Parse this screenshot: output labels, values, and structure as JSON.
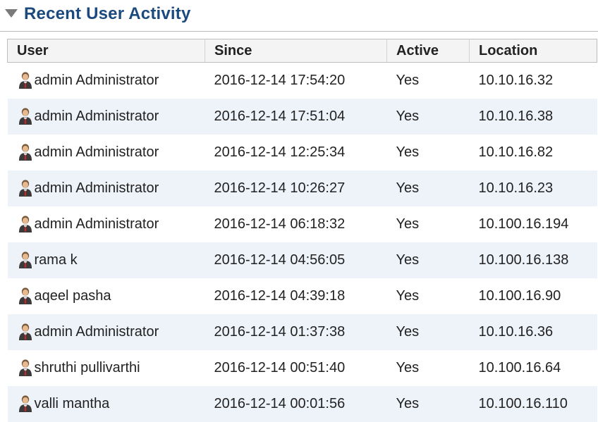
{
  "panel": {
    "title": "Recent User Activity"
  },
  "table": {
    "columns": [
      "User",
      "Since",
      "Active",
      "Location"
    ],
    "rows": [
      {
        "user": "admin Administrator",
        "since": "2016-12-14 17:54:20",
        "active": "Yes",
        "location": "10.10.16.32"
      },
      {
        "user": "admin Administrator",
        "since": "2016-12-14 17:51:04",
        "active": "Yes",
        "location": "10.10.16.38"
      },
      {
        "user": "admin Administrator",
        "since": "2016-12-14 12:25:34",
        "active": "Yes",
        "location": "10.10.16.82"
      },
      {
        "user": "admin Administrator",
        "since": "2016-12-14 10:26:27",
        "active": "Yes",
        "location": "10.10.16.23"
      },
      {
        "user": "admin Administrator",
        "since": "2016-12-14 06:18:32",
        "active": "Yes",
        "location": "10.100.16.194"
      },
      {
        "user": "rama k",
        "since": "2016-12-14 04:56:05",
        "active": "Yes",
        "location": "10.100.16.138"
      },
      {
        "user": "aqeel pasha",
        "since": "2016-12-14 04:39:18",
        "active": "Yes",
        "location": "10.100.16.90"
      },
      {
        "user": "admin Administrator",
        "since": "2016-12-14 01:37:38",
        "active": "Yes",
        "location": "10.10.16.36"
      },
      {
        "user": "shruthi pullivarthi",
        "since": "2016-12-14 00:51:40",
        "active": "Yes",
        "location": "10.100.16.64"
      },
      {
        "user": "valli mantha",
        "since": "2016-12-14 00:01:56",
        "active": "Yes",
        "location": "10.100.16.110"
      }
    ]
  },
  "icons": {
    "collapse": "triangle-down-icon",
    "user": "user-icon"
  },
  "colors": {
    "title": "#1c4a7e",
    "row_alt": "#eef3fa",
    "header_bg": "#f4f4f4"
  }
}
